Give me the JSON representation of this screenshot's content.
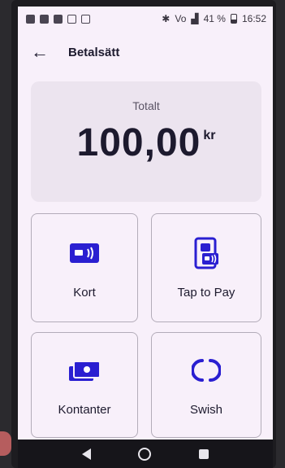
{
  "status_bar": {
    "network": "Vo",
    "battery": "41 %",
    "time": "16:52"
  },
  "app_bar": {
    "back_icon": "arrow-left-icon",
    "title": "Betalsätt"
  },
  "total": {
    "label": "Totalt",
    "amount": "100,00",
    "currency": "kr"
  },
  "payment_methods": [
    {
      "label": "Kort",
      "icon": "card-icon"
    },
    {
      "label": "Tap to Pay",
      "icon": "tap-to-pay-icon"
    },
    {
      "label": "Kontanter",
      "icon": "cash-icon"
    },
    {
      "label": "Swish",
      "icon": "swish-icon"
    }
  ],
  "colors": {
    "accent": "#2a1fd1",
    "background": "#f8f0fa",
    "card": "#ece4ef",
    "text": "#1d1a2e"
  }
}
